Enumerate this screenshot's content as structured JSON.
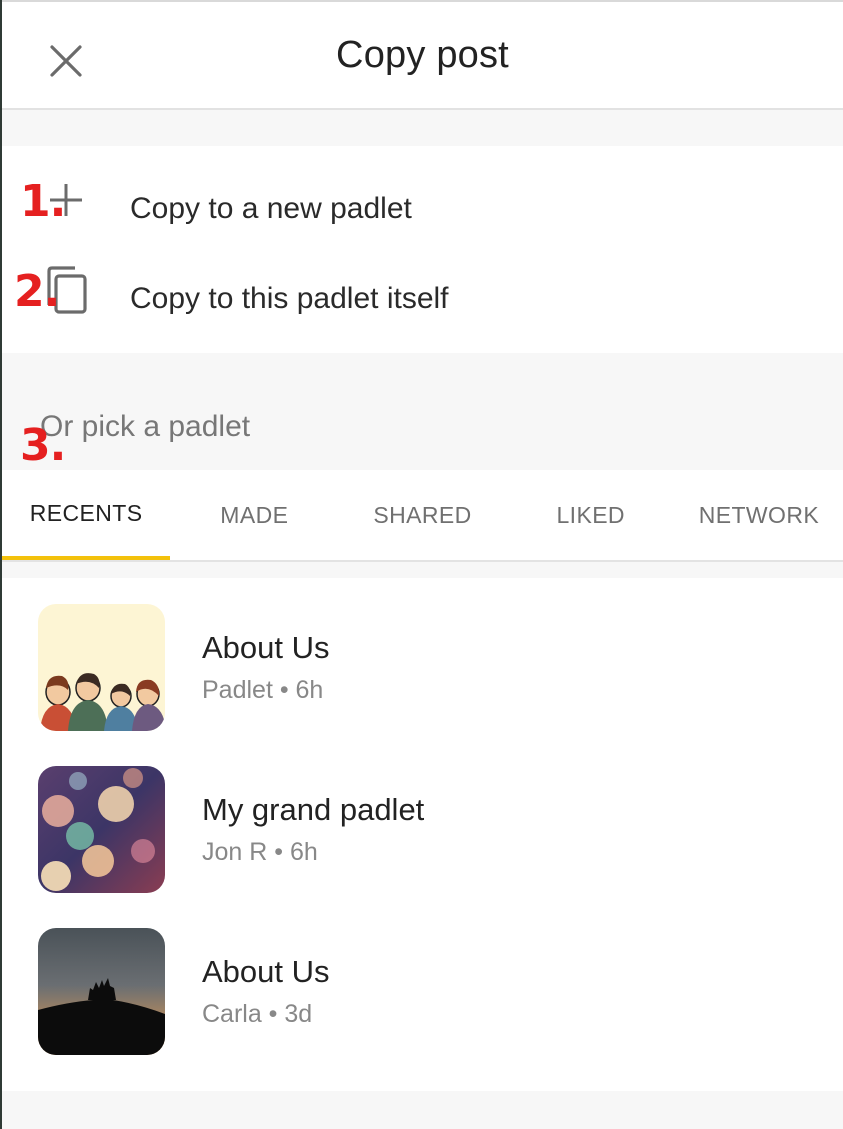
{
  "header": {
    "title": "Copy post",
    "close_icon": "close-icon"
  },
  "options": [
    {
      "label": "Copy to a new padlet",
      "icon": "plus-icon",
      "marker": "1."
    },
    {
      "label": "Copy to this padlet itself",
      "icon": "copy-icon",
      "marker": "2."
    }
  ],
  "pick": {
    "label": "Or pick a padlet",
    "marker": "3."
  },
  "tabs": [
    {
      "label": "RECENTS",
      "active": true
    },
    {
      "label": "MADE",
      "active": false
    },
    {
      "label": "SHARED",
      "active": false
    },
    {
      "label": "LIKED",
      "active": false
    },
    {
      "label": "NETWORK",
      "active": false
    }
  ],
  "padlets": [
    {
      "title": "About Us",
      "author": "Padlet",
      "age": "6h",
      "meta": "Padlet • 6h",
      "thumbnail": "retro-crowd-illustration"
    },
    {
      "title": "My grand padlet",
      "author": "Jon R",
      "age": "6h",
      "meta": "Jon R • 6h",
      "thumbnail": "bokeh-lights"
    },
    {
      "title": "About Us",
      "author": "Carla",
      "age": "3d",
      "meta": "Carla • 3d",
      "thumbnail": "sunset-silhouette"
    }
  ],
  "colors": {
    "active_tab_underline": "#f3c10b",
    "marker": "#e52020",
    "background": "#f7f7f7"
  }
}
